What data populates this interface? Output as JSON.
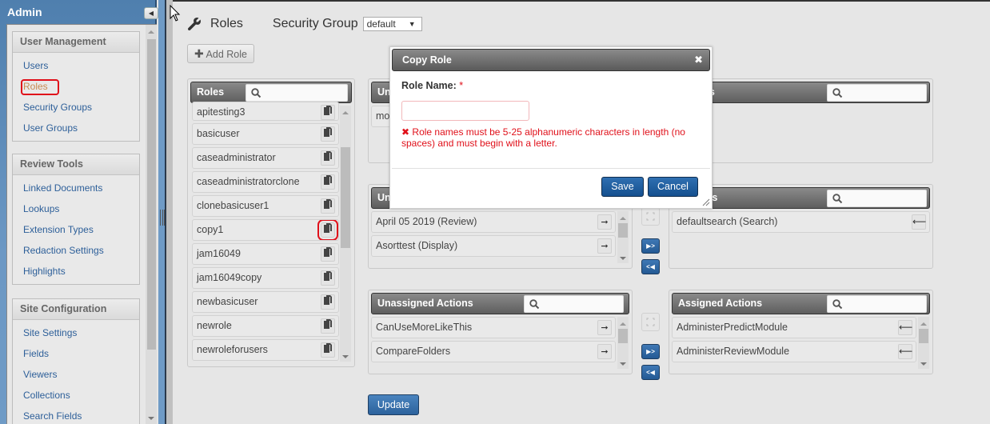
{
  "admin_panel": {
    "title": "Admin",
    "sections": [
      {
        "title": "User Management",
        "items": [
          {
            "label": "Users",
            "active": false
          },
          {
            "label": "Roles",
            "active": true
          },
          {
            "label": "Security Groups",
            "active": false
          },
          {
            "label": "User Groups",
            "active": false
          }
        ]
      },
      {
        "title": "Review Tools",
        "items": [
          {
            "label": "Linked Documents"
          },
          {
            "label": "Lookups"
          },
          {
            "label": "Extension Types"
          },
          {
            "label": "Redaction Settings"
          },
          {
            "label": "Highlights"
          }
        ]
      },
      {
        "title": "Site Configuration",
        "items": [
          {
            "label": "Site Settings"
          },
          {
            "label": "Fields"
          },
          {
            "label": "Viewers"
          },
          {
            "label": "Collections"
          },
          {
            "label": "Search Fields"
          }
        ]
      }
    ]
  },
  "header": {
    "title": "Roles",
    "security_group_label": "Security Group",
    "security_group_value": "default",
    "add_role_label": "Add Role"
  },
  "roles_panel": {
    "title": "Roles",
    "search_value": "",
    "items": [
      "apitesting3",
      "basicuser",
      "caseadministrator",
      "caseadministratorclone",
      "clonebasicuser1",
      "copy1",
      "jam16049",
      "jam16049copy",
      "newbasicuser",
      "newrole",
      "newroleforusers"
    ],
    "highlighted_item": "copy1"
  },
  "users_panels": {
    "unassigned_title": "Un",
    "unassigned_items": [
      "mo"
    ],
    "assigned_title": "d Users",
    "assigned_items": []
  },
  "forms_panels": {
    "unassigned_title": "Un",
    "unassigned_items": [
      "April 05 2019 (Review)",
      "Asorttest (Display)"
    ],
    "assigned_title": "d Forms",
    "assigned_items": [
      "defaultsearch (Search)"
    ]
  },
  "actions_panels": {
    "unassigned_title": "Unassigned Actions",
    "unassigned_items": [
      "CanUseMoreLikeThis",
      "CompareFolders"
    ],
    "assigned_title": "Assigned Actions",
    "assigned_items": [
      "AdministerPredictModule",
      "AdministerReviewModule"
    ]
  },
  "transfer_buttons": {
    "move_all_right": "▶>",
    "move_all_left": "<◀"
  },
  "update_label": "Update",
  "modal": {
    "title": "Copy Role",
    "role_name_label": "Role Name:",
    "required_mark": "*",
    "role_name_value": "",
    "error_message": "Role names must be 5-25 alphanumeric characters in length (no spaces) and must begin with a letter.",
    "save_label": "Save",
    "cancel_label": "Cancel"
  },
  "colors": {
    "accent_blue": "#2d5f99",
    "error_red": "#e0101a",
    "active_link": "#c98a50",
    "header_gray": "#6e6e6e"
  }
}
